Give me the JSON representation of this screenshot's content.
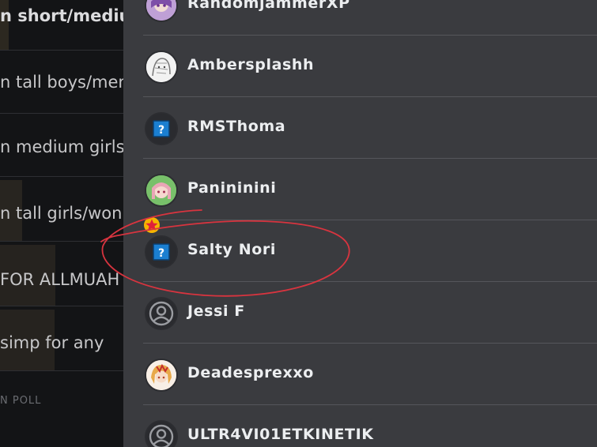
{
  "poll": {
    "options": [
      {
        "text": "n short/mediu",
        "bold": true,
        "fill": 0.07
      },
      {
        "text": "n tall boys/men",
        "bold": false,
        "fill": 0.0
      },
      {
        "text": "n medium girls",
        "bold": false,
        "fill": 0.0
      },
      {
        "text": "n tall girls/won",
        "bold": false,
        "fill": 0.18
      },
      {
        "text": "FOR ALLMUAH",
        "bold": false,
        "fill": 0.45
      },
      {
        "text": "simp for any",
        "bold": false,
        "fill": 0.44
      }
    ],
    "footer": "N POLL"
  },
  "voters": [
    {
      "name": "RandomjammerXP",
      "avatar": "anime-avatar-purple"
    },
    {
      "name": "Ambersplashh",
      "avatar": "anime-avatar-sketch"
    },
    {
      "name": "RMSThoma",
      "avatar": "question-block-icon"
    },
    {
      "name": "Panininini",
      "avatar": "anime-avatar-pink"
    },
    {
      "name": "Salty Nori",
      "avatar": "question-block-icon",
      "badge": "star-badge-icon"
    },
    {
      "name": "Jessi F",
      "avatar": "default-user-icon"
    },
    {
      "name": "Deadesprexxo",
      "avatar": "anime-avatar-blonde"
    },
    {
      "name": "ULTR4VI01ETKINETIK",
      "avatar": "default-user-icon"
    }
  ],
  "colors": {
    "panel": "#3a3b3f",
    "annotation": "#d8343f",
    "badge": "#f5b400"
  }
}
